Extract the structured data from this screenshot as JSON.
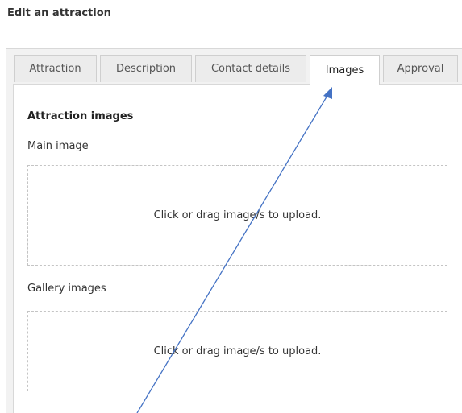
{
  "page": {
    "title": "Edit an attraction"
  },
  "tabs": [
    {
      "label": "Attraction",
      "active": false
    },
    {
      "label": "Description",
      "active": false
    },
    {
      "label": "Contact details",
      "active": false
    },
    {
      "label": "Images",
      "active": true
    },
    {
      "label": "Approval",
      "active": false
    }
  ],
  "images_section": {
    "heading": "Attraction images",
    "main_image": {
      "label": "Main image",
      "dropzone_text": "Click or drag image/s to upload."
    },
    "gallery_images": {
      "label": "Gallery images",
      "dropzone_text": "Click or drag image/s to upload."
    }
  },
  "annotation": {
    "arrow_color": "#4472c4",
    "points_to": "tab-images"
  }
}
